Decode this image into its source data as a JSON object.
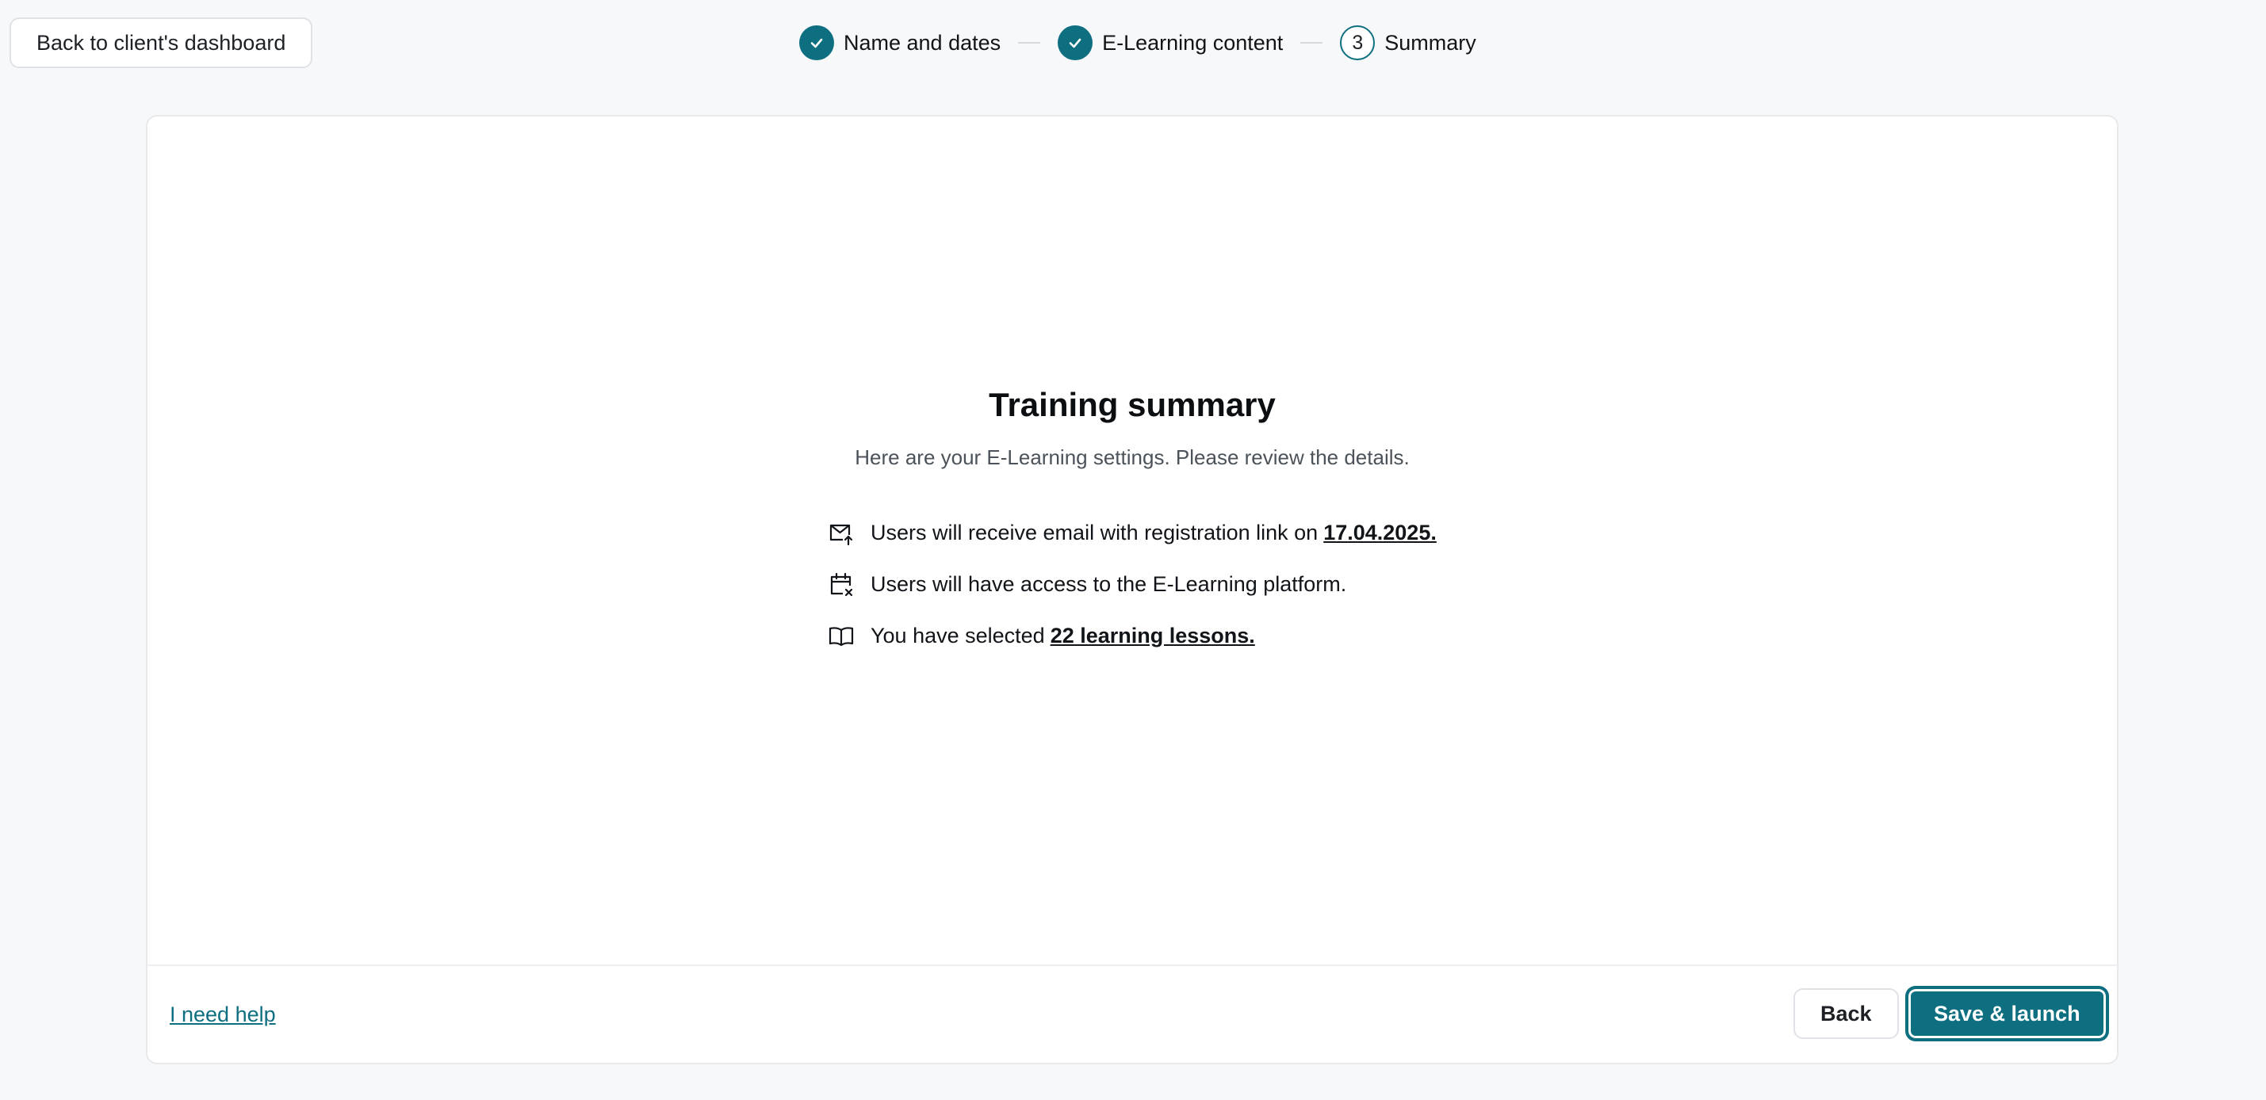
{
  "topbar": {
    "back_label": "Back to client's dashboard"
  },
  "stepper": {
    "steps": [
      {
        "label": "Name and dates",
        "state": "done"
      },
      {
        "label": "E-Learning content",
        "state": "done"
      },
      {
        "label": "Summary",
        "state": "current",
        "number": "3"
      }
    ]
  },
  "summary": {
    "title": "Training summary",
    "subtitle": "Here are your E-Learning settings. Please review the details.",
    "items": [
      {
        "icon": "mail-upload-icon",
        "text": "Users will receive email with registration link on",
        "highlight": "17.04.2025."
      },
      {
        "icon": "calendar-x-icon",
        "text": "Users will have access to the E-Learning platform.",
        "highlight": ""
      },
      {
        "icon": "book-open-icon",
        "text": "You have selected",
        "highlight": "22 learning lessons."
      }
    ]
  },
  "footer": {
    "help_label": "I need help",
    "back_label": "Back",
    "save_label": "Save & launch"
  },
  "colors": {
    "accent": "#0e6f80",
    "background": "#f7f8fa",
    "card": "#ffffff"
  }
}
